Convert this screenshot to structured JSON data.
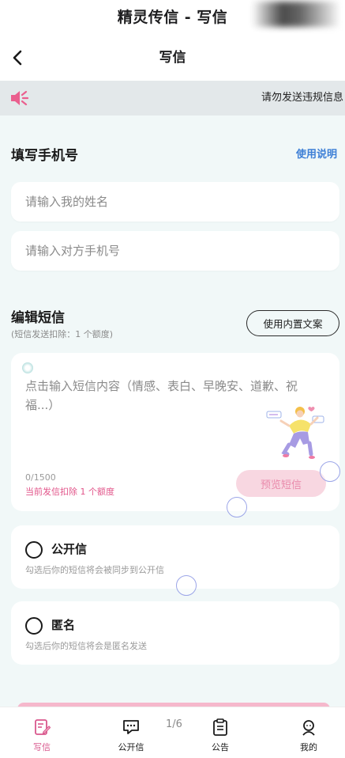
{
  "app": {
    "title": "精灵传信 - 写信"
  },
  "nav": {
    "title": "写信"
  },
  "notice": {
    "text": "请勿发送违规信息"
  },
  "recipient": {
    "heading": "填写手机号",
    "help_link": "使用说明",
    "name_placeholder": "请输入我的姓名",
    "phone_placeholder": "请输入对方手机号"
  },
  "compose": {
    "heading": "编辑短信",
    "sub_note": "(短信发送扣除：1 个额度)",
    "preset_button": "使用内置文案",
    "placeholder": "点击输入短信内容（情感、表白、早晚安、道歉、祝福...）",
    "counter": "0/1500",
    "cost_note": "当前发信扣除 1 个额度",
    "preview_button": "预览短信"
  },
  "options": [
    {
      "label": "公开信",
      "hint": "勾选后你的短信将会被同步到公开信",
      "checked": false
    },
    {
      "label": "匿名",
      "hint": "勾选后你的短信将会是匿名发送",
      "checked": false
    }
  ],
  "page_indicator": "1/6",
  "tabbar": {
    "items": [
      {
        "label": "写信",
        "icon": "compose-icon",
        "active": true
      },
      {
        "label": "公开信",
        "icon": "chat-bubble-icon",
        "active": false
      },
      {
        "label": "公告",
        "icon": "clipboard-icon",
        "active": false
      },
      {
        "label": "我的",
        "icon": "user-icon",
        "active": false
      }
    ]
  },
  "colors": {
    "accent_pink": "#d9588d",
    "link_blue": "#3d7fd6",
    "page_bg": "#f1f8f8",
    "preview_bg": "#f8d7e1"
  }
}
